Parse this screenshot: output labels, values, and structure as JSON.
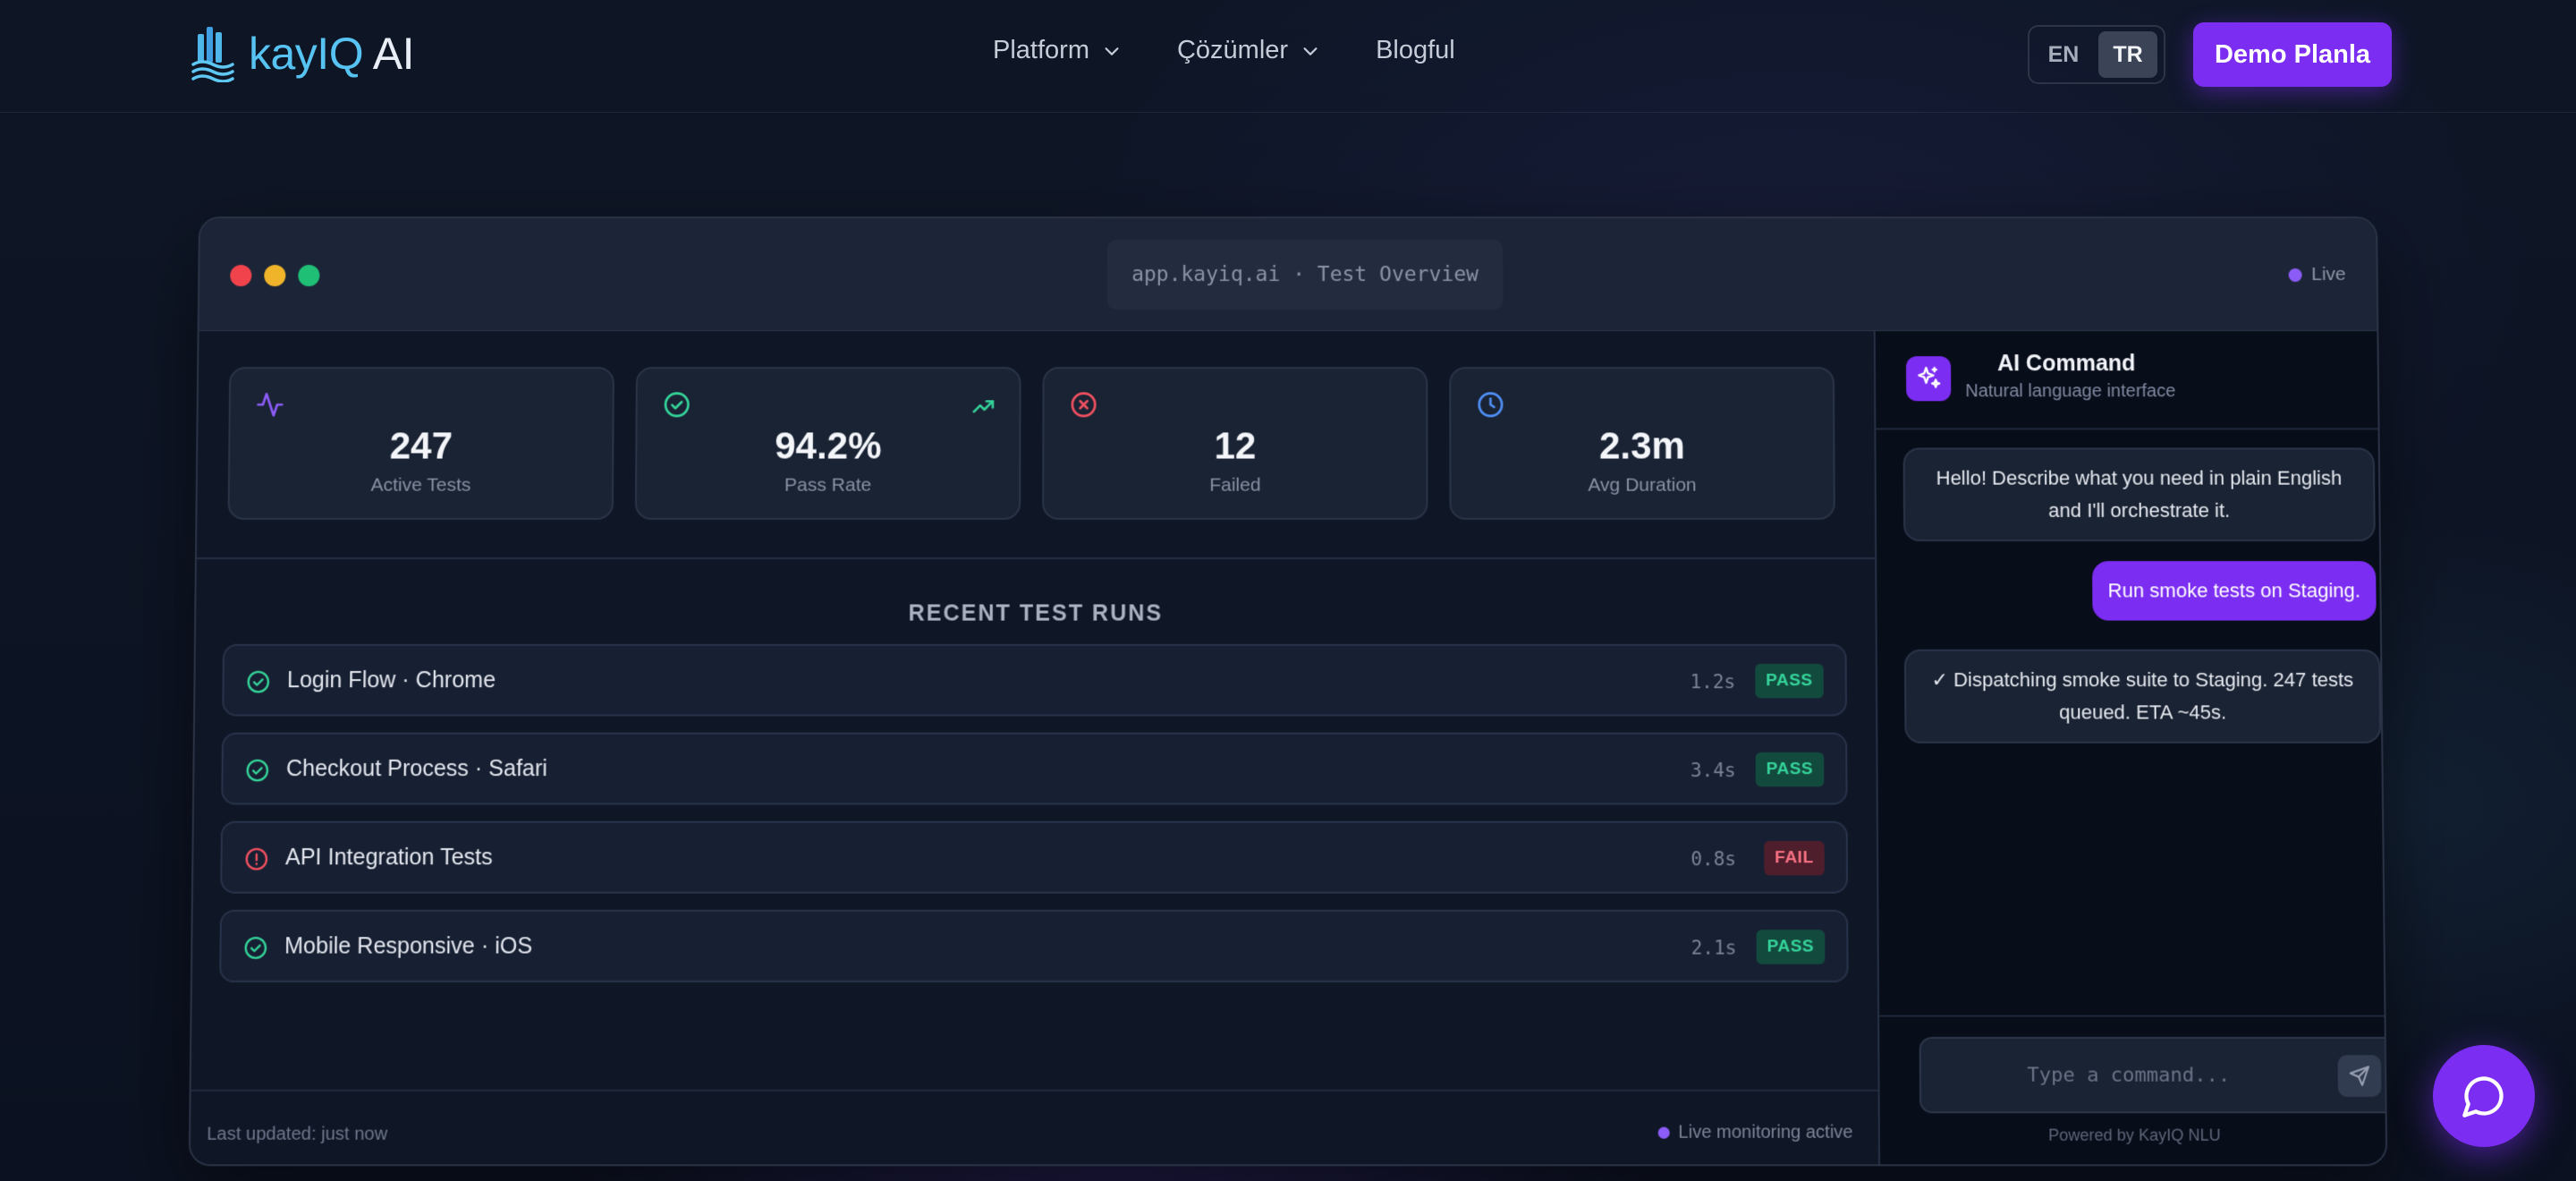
{
  "brand": {
    "name_part1": "kayIQ",
    "name_part2": " AI"
  },
  "nav": {
    "links": [
      {
        "label": "Platform",
        "has_dropdown": true
      },
      {
        "label": "Çözümler",
        "has_dropdown": true
      },
      {
        "label": "Blogful",
        "has_dropdown": false
      }
    ],
    "language": {
      "options": [
        "EN",
        "TR"
      ],
      "selected": "TR"
    },
    "cta_label": "Demo Planla"
  },
  "window": {
    "url": "app.kayiq.ai · Test Overview",
    "live_label": "Live"
  },
  "stats": [
    {
      "icon": "activity-icon",
      "value": "247",
      "label": "Active Tests"
    },
    {
      "icon": "check-circle-icon",
      "value": "94.2%",
      "label": "Pass Rate",
      "trend_icon": "trending-up-icon"
    },
    {
      "icon": "x-circle-icon",
      "value": "12",
      "label": "Failed"
    },
    {
      "icon": "clock-icon",
      "value": "2.3m",
      "label": "Avg Duration"
    }
  ],
  "runs": {
    "title": "RECENT TEST RUNS",
    "items": [
      {
        "name": "Login Flow · Chrome",
        "duration": "1.2s",
        "status": "PASS"
      },
      {
        "name": "Checkout Process · Safari",
        "duration": "3.4s",
        "status": "PASS"
      },
      {
        "name": "API Integration Tests",
        "duration": "0.8s",
        "status": "FAIL"
      },
      {
        "name": "Mobile Responsive · iOS",
        "duration": "2.1s",
        "status": "PASS"
      }
    ]
  },
  "footer": {
    "updated": "Last updated: just now",
    "monitoring": "Live monitoring active"
  },
  "ai_command": {
    "title": "AI Command",
    "subtitle": "Natural language interface",
    "messages": [
      {
        "role": "bot",
        "text": "Hello! Describe what you need in plain English and I'll orchestrate it."
      },
      {
        "role": "user",
        "text": "Run smoke tests on Staging."
      },
      {
        "role": "bot",
        "text": "✓ Dispatching smoke suite to Staging. 247 tests queued. ETA ~45s."
      }
    ],
    "input_placeholder": "Type a command...",
    "powered_by": "Powered by KayIQ NLU"
  },
  "colors": {
    "accent": "#7c2df2",
    "brand_blue": "#57c3f2",
    "pass": "#34d399",
    "fail": "#f87182",
    "background": "#0d1424"
  }
}
